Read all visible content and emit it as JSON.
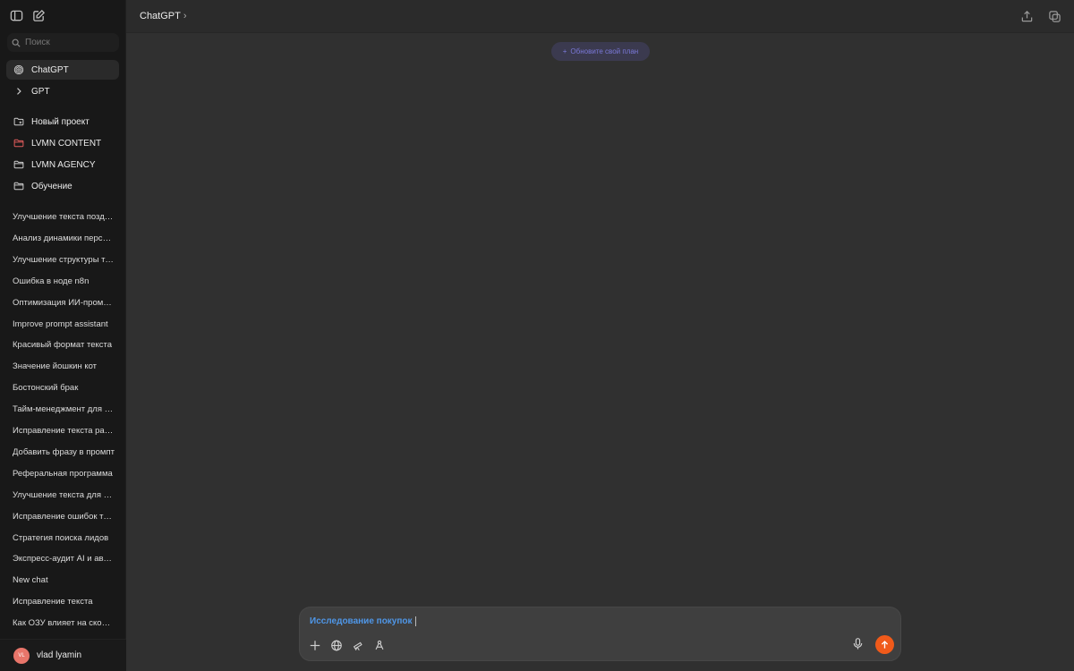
{
  "header": {
    "model": "ChatGPT",
    "chevron": "›"
  },
  "search": {
    "placeholder": "Поиск"
  },
  "nav": [
    {
      "label": "ChatGPT",
      "icon": "openai-logo-icon"
    },
    {
      "label": "GPT",
      "icon": "chevron-right-icon"
    }
  ],
  "projects": [
    {
      "label": "Новый проект",
      "icon": "folder-plus-icon",
      "color": "#cfcfcf"
    },
    {
      "label": "LVMN CONTENT",
      "icon": "folder-icon",
      "color": "#e25c5c"
    },
    {
      "label": "LVMN AGENCY",
      "icon": "folder-icon",
      "color": "#cfcfcf"
    },
    {
      "label": "Обучение",
      "icon": "folder-icon",
      "color": "#cfcfcf"
    }
  ],
  "chats": [
    "Улучшение текста поздравления",
    "Анализ динамики персонала",
    "Улучшение структуры текста",
    "Ошибка в ноде n8n",
    "Оптимизация ИИ-промпта",
    "Improve prompt assistant",
    "Красивый формат текста",
    "Значение йошкин кот",
    "Бостонский брак",
    "Тайм-менеджмент для фрилансера",
    "Исправление текста рассылки",
    "Добавить фразу в промпт",
    "Реферальная программа",
    "Улучшение текста для поста",
    "Исправление ошибок текста",
    "Стратегия поиска лидов",
    "Экспресс-аудит AI и автоматизации",
    "New chat",
    "Исправление текста",
    "Как ОЗУ влияет на скорость"
  ],
  "user": {
    "initials": "VL",
    "name": "vlad lyamin"
  },
  "upgrade": {
    "plus": "+",
    "label": "Обновите свой план"
  },
  "composer": {
    "text": "Исследование покупок"
  },
  "colors": {
    "accent": "#f05a1a",
    "link": "#4f97e8",
    "upgrade_text": "#7a78d8"
  }
}
